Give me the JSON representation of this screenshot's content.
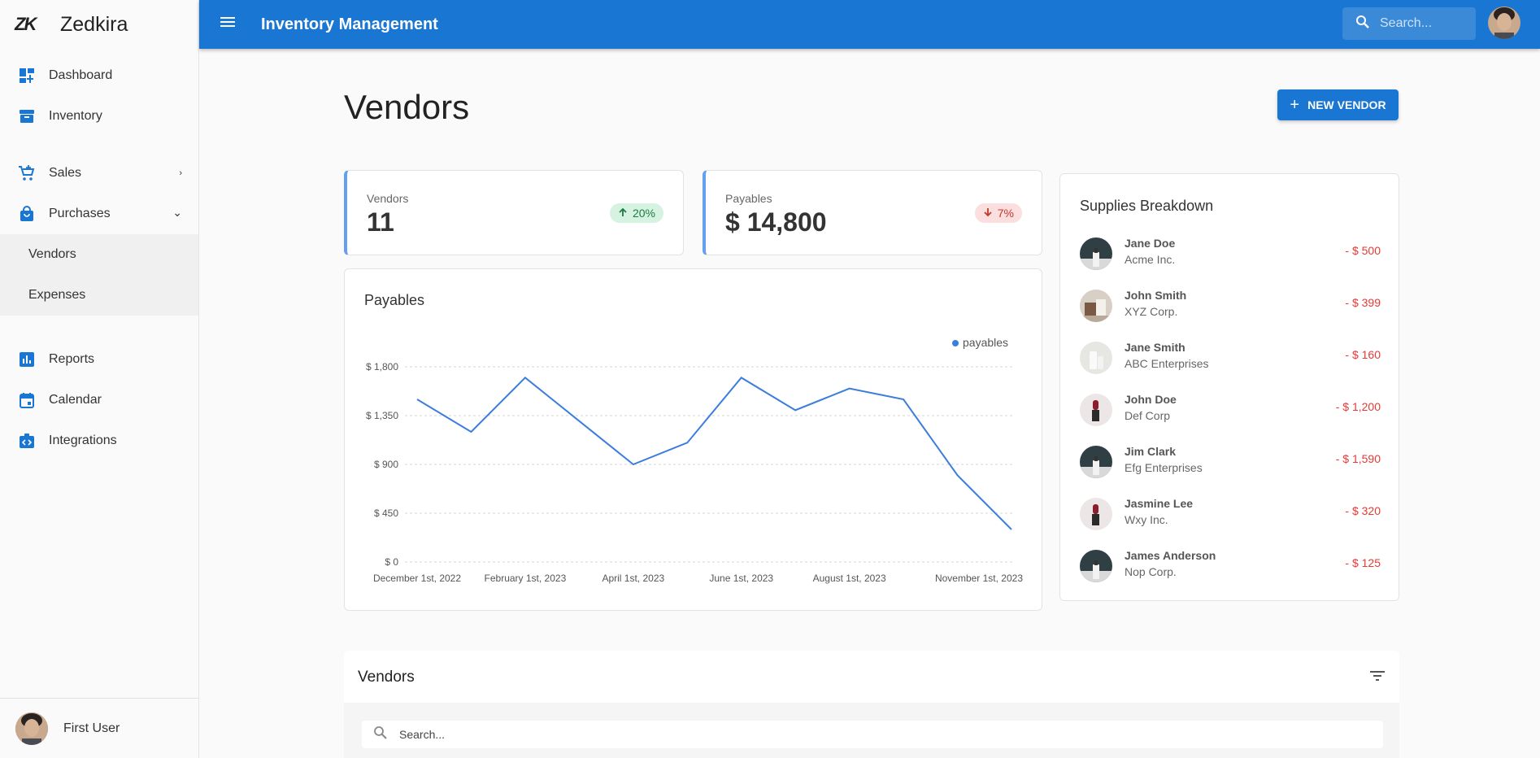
{
  "brand": {
    "logo": "ZK",
    "name": "Zedkira"
  },
  "sidebar": {
    "items": [
      {
        "label": "Dashboard"
      },
      {
        "label": "Inventory"
      },
      {
        "label": "Sales",
        "caret": "›"
      },
      {
        "label": "Purchases",
        "caret": "⌄"
      },
      {
        "label": "Reports"
      },
      {
        "label": "Calendar"
      },
      {
        "label": "Integrations"
      }
    ],
    "purchases_sub": [
      {
        "label": "Vendors"
      },
      {
        "label": "Expenses"
      }
    ],
    "user": {
      "name": "First User"
    }
  },
  "topbar": {
    "title": "Inventory Management",
    "search_placeholder": "Search..."
  },
  "page": {
    "title": "Vendors",
    "new_button": "NEW VENDOR"
  },
  "stats": {
    "vendors": {
      "label": "Vendors",
      "value": "11",
      "badge": "20%",
      "trend": "up"
    },
    "payables": {
      "label": "Payables",
      "value": "$ 14,800",
      "badge": "7%",
      "trend": "down"
    }
  },
  "chart_card": {
    "title": "Payables"
  },
  "chart_data": {
    "type": "line",
    "series": [
      {
        "name": "payables",
        "color": "#3b7ddd",
        "values": [
          1500,
          1200,
          1700,
          1300,
          900,
          1100,
          1700,
          1400,
          1600,
          1500,
          800,
          300
        ]
      }
    ],
    "x": [
      "2022-12-01",
      "2023-01-01",
      "2023-02-01",
      "2023-03-01",
      "2023-04-01",
      "2023-05-01",
      "2023-06-01",
      "2023-07-01",
      "2023-08-01",
      "2023-09-01",
      "2023-10-01",
      "2023-11-01"
    ],
    "tick_labels": [
      "December 1st, 2022",
      "February 1st, 2023",
      "April 1st, 2023",
      "June 1st, 2023",
      "August 1st, 2023",
      "November 1st, 2023"
    ],
    "y_ticks": [
      "$ 0",
      "$ 450",
      "$ 900",
      "$ 1,350",
      "$ 1,800"
    ],
    "ylim": [
      0,
      1800
    ],
    "grid": true,
    "legend": "top-right"
  },
  "supplies": {
    "title": "Supplies Breakdown",
    "rows": [
      {
        "name": "Jane Doe",
        "company": "Acme Inc.",
        "amount": "- $ 500",
        "avatar": "dark-bottle"
      },
      {
        "name": "John Smith",
        "company": "XYZ Corp.",
        "amount": "- $ 399",
        "avatar": "tan-jar"
      },
      {
        "name": "Jane Smith",
        "company": "ABC Enterprises",
        "amount": "- $ 160",
        "avatar": "white-bottle"
      },
      {
        "name": "John Doe",
        "company": "Def Corp",
        "amount": "- $ 1,200",
        "avatar": "lipstick"
      },
      {
        "name": "Jim Clark",
        "company": "Efg Enterprises",
        "amount": "- $ 1,590",
        "avatar": "dark-bottle"
      },
      {
        "name": "Jasmine Lee",
        "company": "Wxy Inc.",
        "amount": "- $ 320",
        "avatar": "lipstick"
      },
      {
        "name": "James Anderson",
        "company": "Nop Corp.",
        "amount": "- $ 125",
        "avatar": "dark-bottle"
      }
    ]
  },
  "vendors_table": {
    "title": "Vendors",
    "search_placeholder": "Search..."
  },
  "colors": {
    "primary": "#1976d2",
    "accent_line": "#64a0ee",
    "negative": "#e53935",
    "positive": "#1f7a44"
  }
}
